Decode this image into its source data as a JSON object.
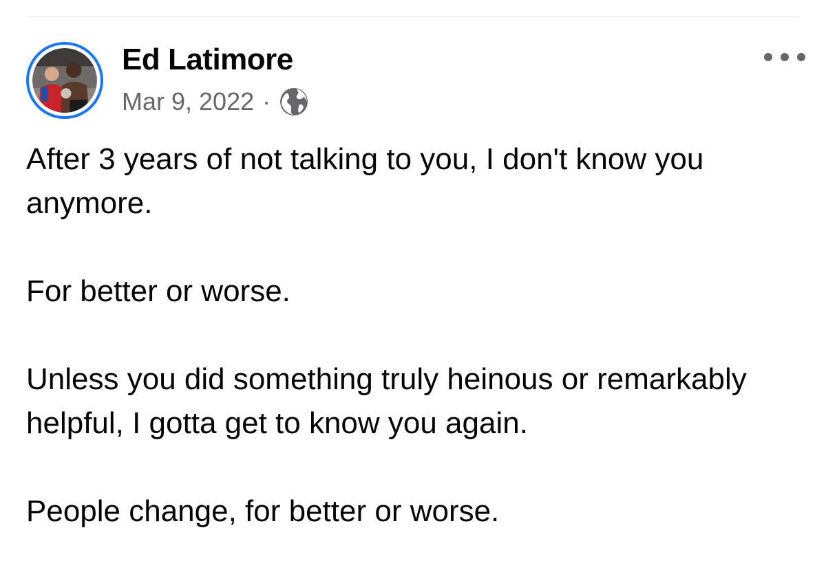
{
  "post": {
    "author": "Ed Latimore",
    "date": "Mar 9, 2022",
    "separator": "·",
    "audience_icon": "globe-icon",
    "menu_icon": "more-options-icon",
    "avatar_ring_color": "#1877f2",
    "paragraphs": [
      "After 3 years of not talking to you, I don't know you anymore.",
      "For better or worse.",
      "Unless you did something truly heinous or remarkably helpful, I gotta get to know you again.",
      "People change, for better or worse."
    ]
  }
}
